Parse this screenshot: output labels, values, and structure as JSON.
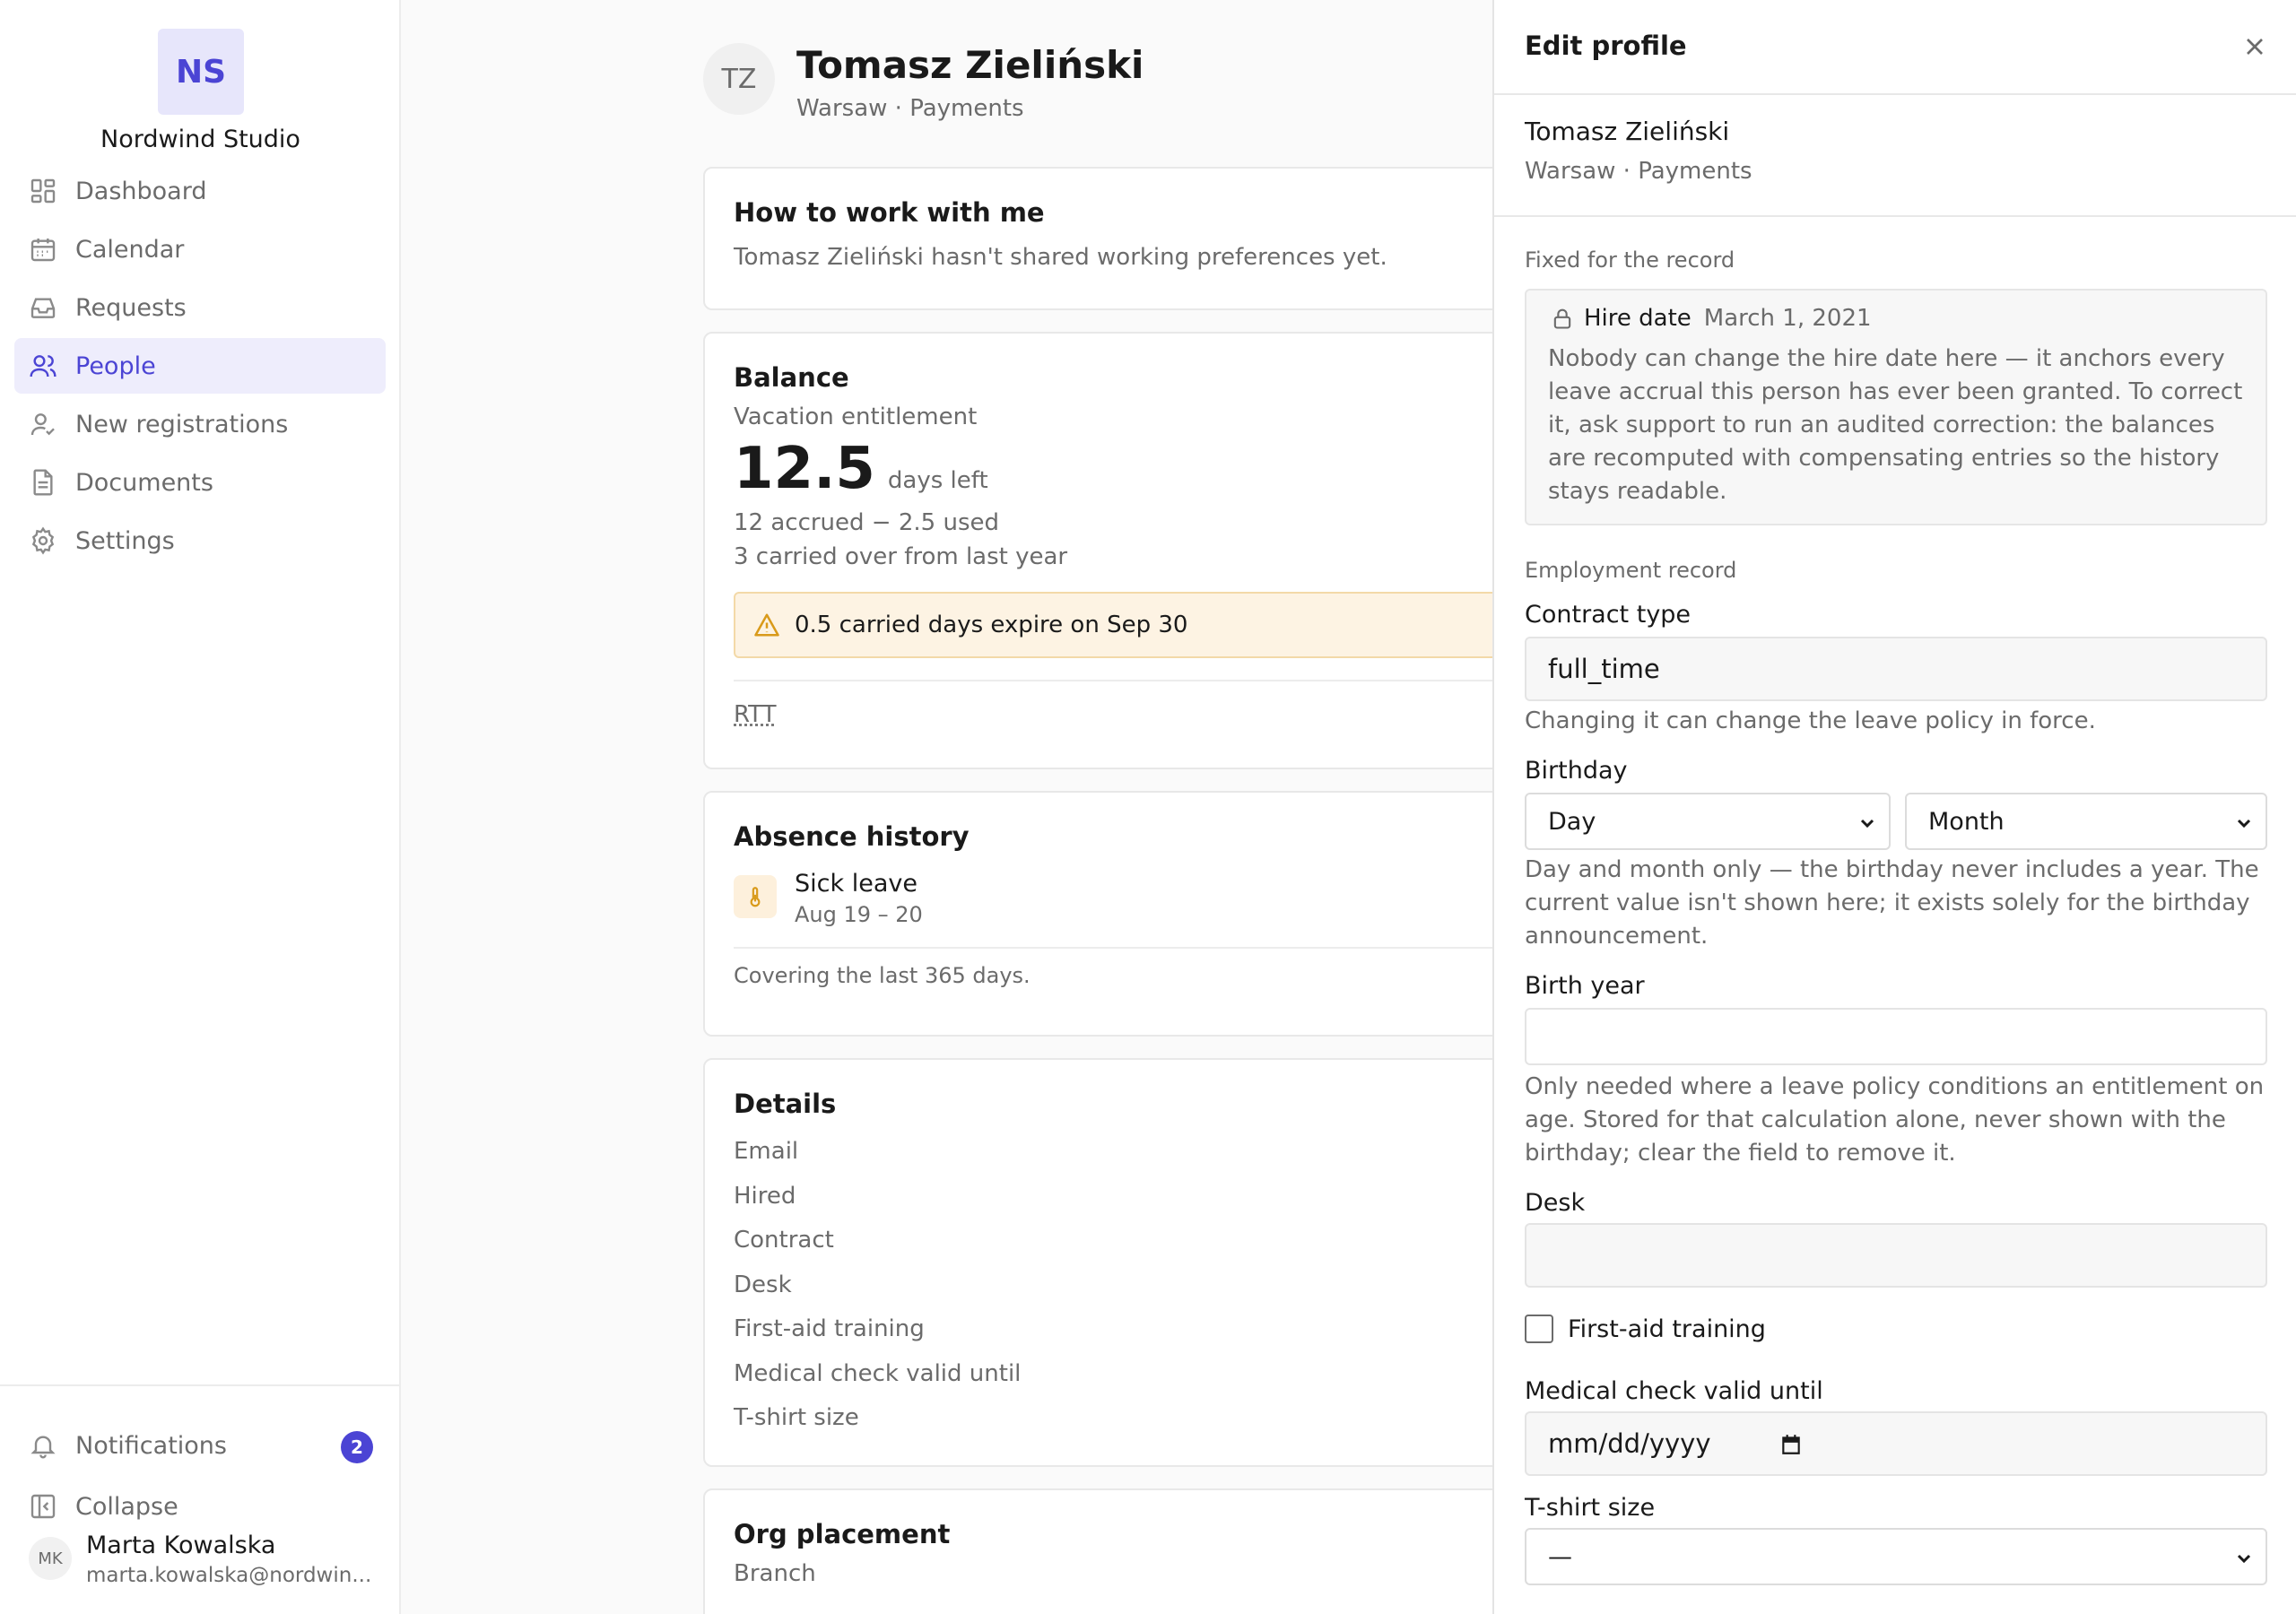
{
  "sidebar": {
    "logo_initials": "NS",
    "org_name": "Nordwind Studio",
    "items": [
      {
        "label": "Dashboard",
        "icon": "dashboard-icon"
      },
      {
        "label": "Calendar",
        "icon": "calendar-icon"
      },
      {
        "label": "Requests",
        "icon": "inbox-icon"
      },
      {
        "label": "People",
        "icon": "people-icon",
        "active": true
      },
      {
        "label": "New registrations",
        "icon": "user-check-icon"
      },
      {
        "label": "Documents",
        "icon": "document-icon"
      },
      {
        "label": "Settings",
        "icon": "gear-icon"
      }
    ],
    "notifications_label": "Notifications",
    "notifications_count": "2",
    "collapse_label": "Collapse",
    "user": {
      "initials": "MK",
      "name": "Marta Kowalska",
      "email": "marta.kowalska@nordwin..."
    }
  },
  "profile": {
    "initials": "TZ",
    "name": "Tomasz Zieliński",
    "subtitle": "Warsaw · Payments"
  },
  "work_with_me": {
    "title": "How to work with me",
    "text": "Tomasz Zieliński hasn't shared working preferences yet."
  },
  "balance": {
    "title": "Balance",
    "label": "Vacation entitlement",
    "days_left": "12.5",
    "days_left_unit": "days left",
    "accrued_used": "12 accrued − 2.5 used",
    "carried_over": "3 carried over from last year",
    "warning": "0.5 carried days expire on Sep 30",
    "rtt_label": "RTT"
  },
  "absence": {
    "title": "Absence history",
    "items": [
      {
        "type": "Sick leave",
        "dates": "Aug 19 – 20"
      }
    ],
    "note": "Covering the last 365 days."
  },
  "details": {
    "title": "Details",
    "rows": [
      "Email",
      "Hired",
      "Contract",
      "Desk",
      "First-aid training",
      "Medical check valid until",
      "T-shirt size"
    ]
  },
  "org_placement": {
    "title": "Org placement",
    "rows": [
      "Branch"
    ]
  },
  "drawer": {
    "title": "Edit profile",
    "person_name": "Tomasz Zieliński",
    "person_sub": "Warsaw · Payments",
    "fixed_section_label": "Fixed for the record",
    "hire_date_label": "Hire date",
    "hire_date_value": "March 1, 2021",
    "hire_date_note": "Nobody can change the hire date here — it anchors every leave accrual this person has ever been granted. To correct it, ask support to run an audited correction: the balances are recomputed with compensating entries so the history stays readable.",
    "employment_section_label": "Employment record",
    "contract_label": "Contract type",
    "contract_value": "full_time",
    "contract_help": "Changing it can change the leave policy in force.",
    "birthday_label": "Birthday",
    "day_placeholder": "Day",
    "month_placeholder": "Month",
    "birthday_help": "Day and month only — the birthday never includes a year. The current value isn't shown here; it exists solely for the birthday announcement.",
    "birth_year_label": "Birth year",
    "birth_year_value": "",
    "birth_year_help": "Only needed where a leave policy conditions an entitlement on age. Stored for that calculation alone, never shown with the birthday; clear the field to remove it.",
    "desk_label": "Desk",
    "desk_value": "",
    "first_aid_label": "First-aid training",
    "medical_label": "Medical check valid until",
    "medical_placeholder": "mm/dd/yyyy",
    "tshirt_label": "T-shirt size",
    "tshirt_value": "—"
  }
}
